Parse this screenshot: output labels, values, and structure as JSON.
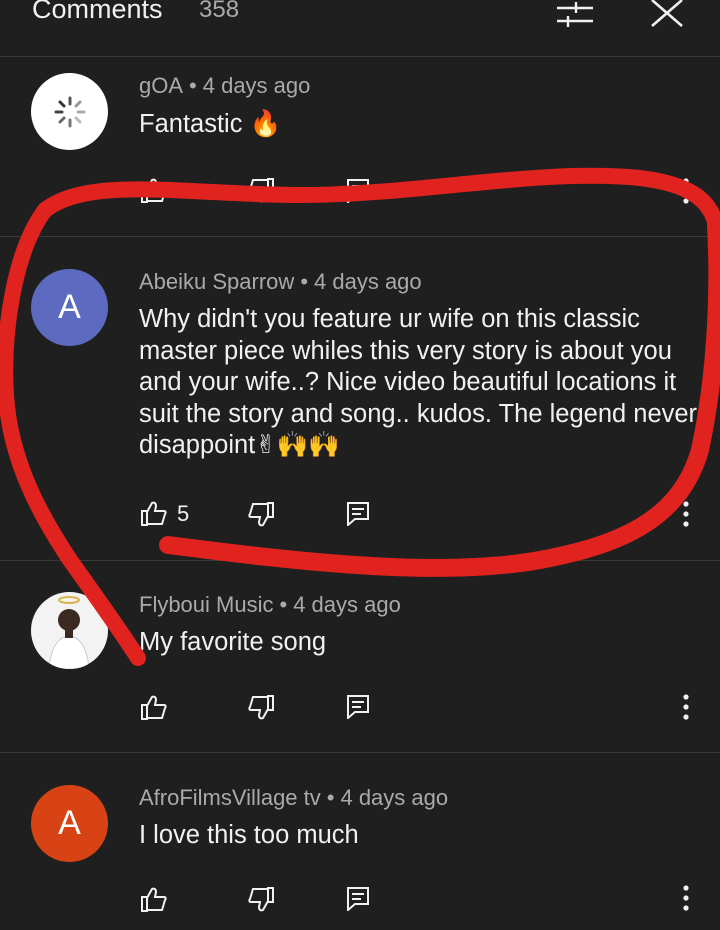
{
  "header": {
    "title": "Comments",
    "count": "358"
  },
  "comments": [
    {
      "author": "gOA",
      "time": "4 days ago",
      "text": "Fantastic 🔥",
      "likes": "",
      "avatar_letter": "",
      "avatar_color": "#ffffff"
    },
    {
      "author": "Abeiku Sparrow",
      "time": "4 days ago",
      "text": "Why didn't you feature ur wife on this classic master piece whiles this very story is about you and your wife..? Nice video beautiful locations it suit the story and song.. kudos. The legend never disappoint✌🙌🙌",
      "likes": "5",
      "avatar_letter": "A",
      "avatar_color": "#5c6bc0"
    },
    {
      "author": "Flyboui Music",
      "time": "4 days ago",
      "text": "My favorite song",
      "likes": "",
      "avatar_letter": "",
      "avatar_color": "#f3f3f3"
    },
    {
      "author": "AfroFilmsVillage tv",
      "time": "4 days ago",
      "text": "I love this too much",
      "likes": "",
      "avatar_letter": "A",
      "avatar_color": "#d84315"
    }
  ],
  "colors": {
    "background": "#1f1f1f",
    "annotation": "#e0231e",
    "meta": "#aaaaaa"
  },
  "icons": [
    "filter-icon",
    "close-icon",
    "thumb-up-icon",
    "thumb-down-icon",
    "reply-icon",
    "more-vert-icon",
    "loading-icon"
  ]
}
